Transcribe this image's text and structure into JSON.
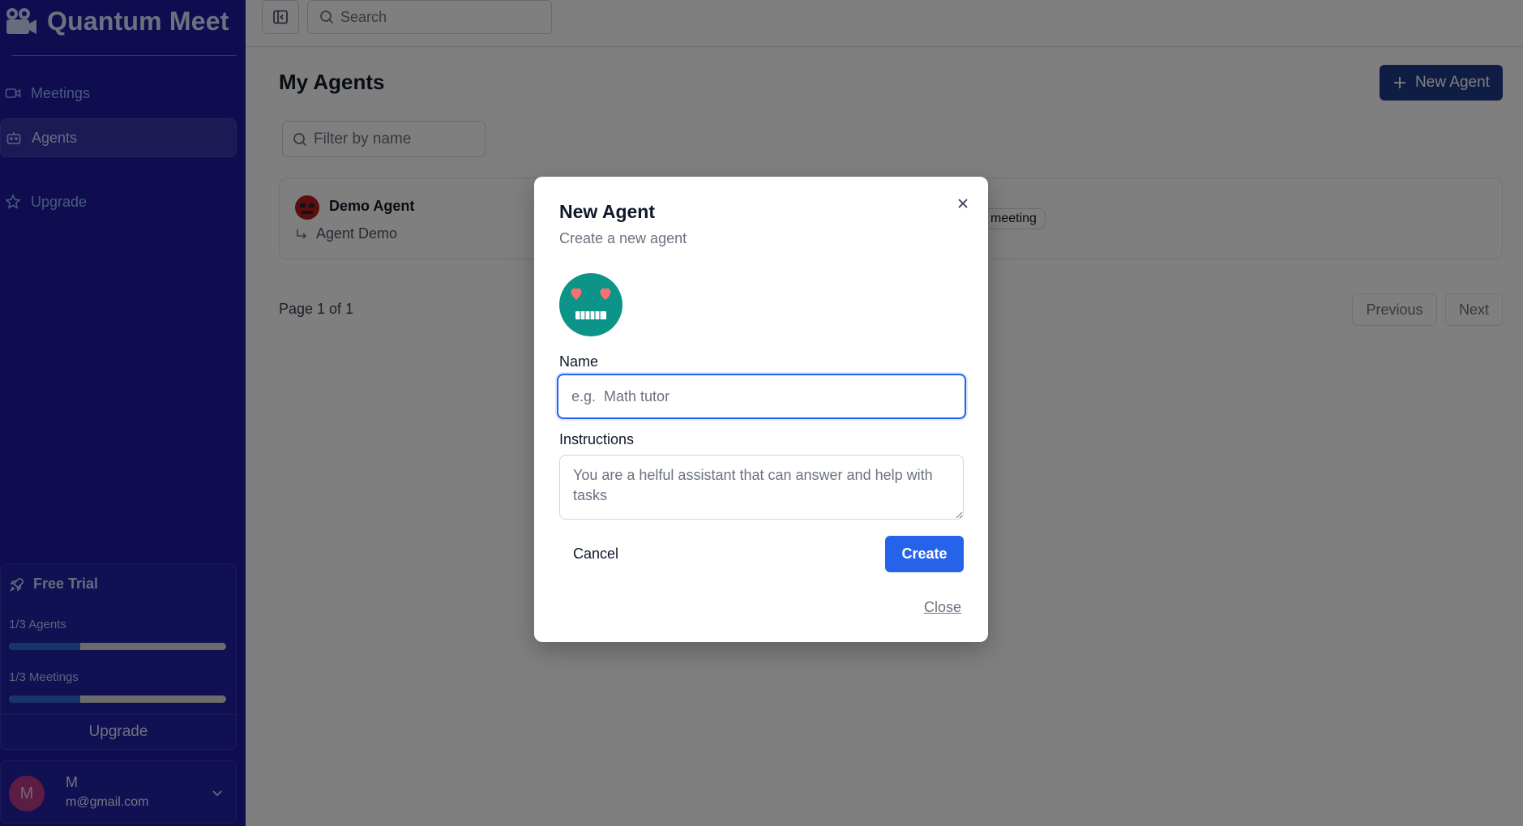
{
  "app": {
    "name": "Quantum Meet"
  },
  "sidebar": {
    "items": [
      {
        "label": "Meetings",
        "icon": "video-icon"
      },
      {
        "label": "Agents",
        "icon": "bot-icon",
        "active": true
      },
      {
        "label": "Upgrade",
        "icon": "star-icon"
      }
    ],
    "trial": {
      "title": "Free Trial",
      "agents_label": "1/3 Agents",
      "agents_progress": 0.33,
      "meetings_label": "1/3 Meetings",
      "meetings_progress": 0.33,
      "upgrade_label": "Upgrade"
    },
    "user": {
      "initial": "M",
      "name": "M",
      "email": "m@gmail.com"
    }
  },
  "topbar": {
    "search_placeholder": "Search"
  },
  "main": {
    "title": "My Agents",
    "new_agent_label": "New Agent",
    "filter_placeholder": "Filter by name",
    "agents": [
      {
        "name": "Demo Agent",
        "instructions": "Agent Demo",
        "badge": "meeting"
      }
    ],
    "pagination": {
      "info": "Page 1 of 1",
      "previous": "Previous",
      "next": "Next"
    }
  },
  "modal": {
    "title": "New Agent",
    "description": "Create a new agent",
    "name_label": "Name",
    "name_placeholder": "e.g.  Math tutor",
    "instructions_label": "Instructions",
    "instructions_placeholder": "You are a helful assistant that can answer and help with tasks",
    "cancel_label": "Cancel",
    "create_label": "Create",
    "close_label": "Close"
  },
  "colors": {
    "sidebar_bg": "#1e1a9e",
    "accent": "#2563eb",
    "primary_button": "#1e3a8a",
    "avatar_teal": "#0d9488"
  }
}
